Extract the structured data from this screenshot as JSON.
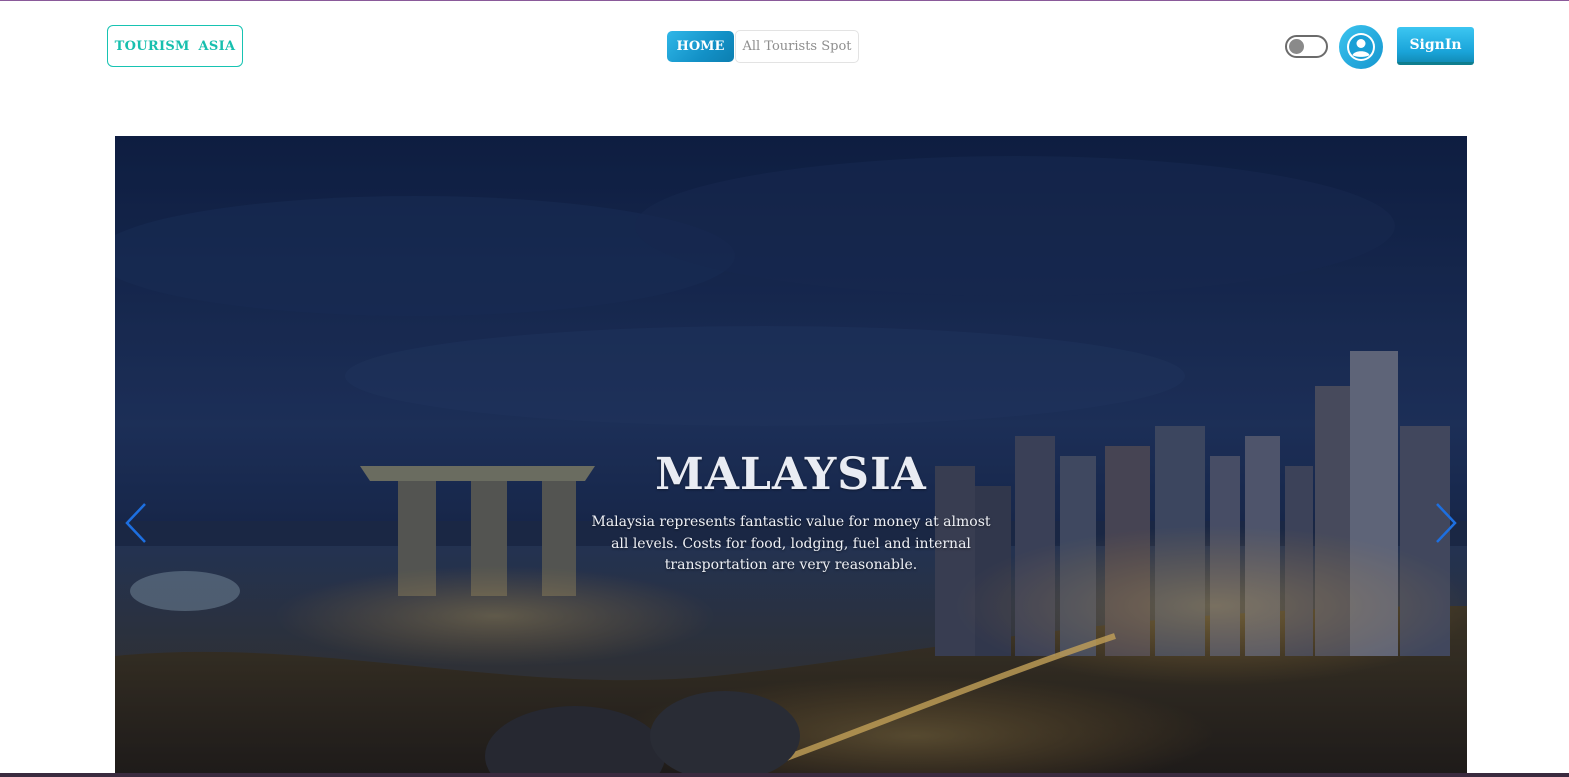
{
  "nav": {
    "brand": "TOURISM  ASIA",
    "links": [
      {
        "label": "HOME",
        "active": true
      },
      {
        "label": "All Tourists Spot",
        "active": false
      }
    ],
    "theme_toggle": {
      "state": "off"
    },
    "avatar_icon": "user-circle-icon",
    "signin_label": "SignIn"
  },
  "hero": {
    "title": "MALAYSIA",
    "description": "Malaysia represents fantastic value for money at almost all levels. Costs for food, lodging, fuel and internal transportation are very reasonable.",
    "prev_icon": "chevron-left-icon",
    "next_icon": "chevron-right-icon"
  },
  "colors": {
    "brand_accent": "#17c3b2",
    "primary_button": "#1aa4d9",
    "carousel_arrow": "#1d6fe0"
  }
}
